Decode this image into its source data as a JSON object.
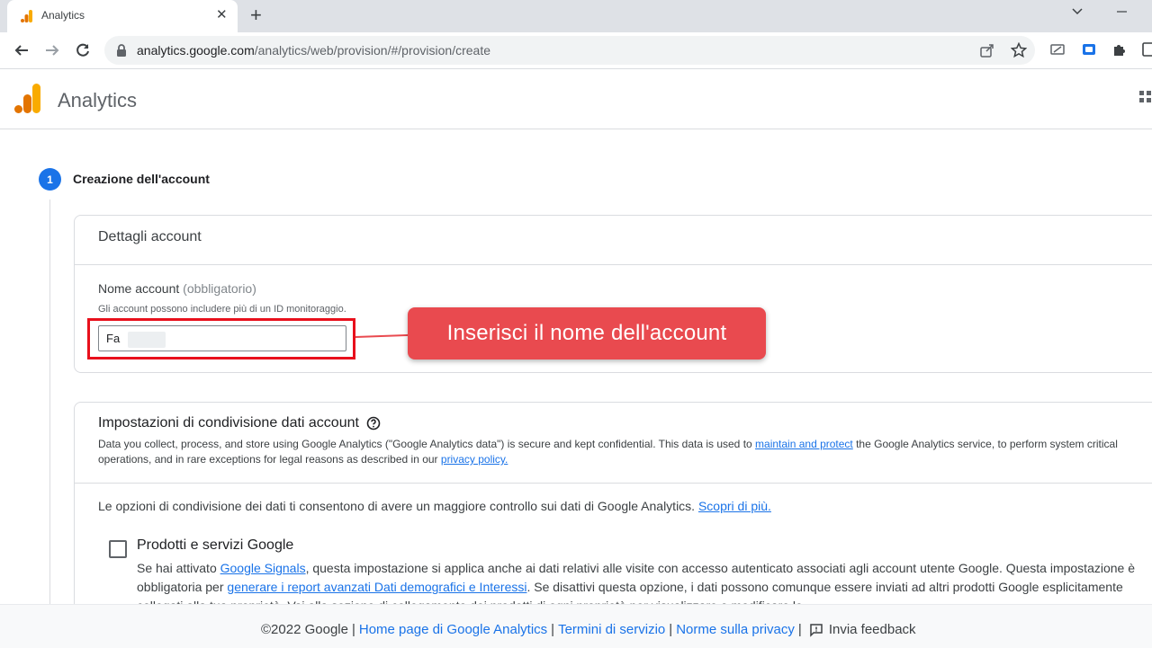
{
  "browser": {
    "tab_title": "Analytics",
    "url_host": "analytics.google.com",
    "url_path": "/analytics/web/provision/#/provision/create"
  },
  "app": {
    "title": "Analytics"
  },
  "step": {
    "number": "1",
    "title": "Creazione dell'account"
  },
  "account_details": {
    "title": "Dettagli account",
    "field_label": "Nome account",
    "field_optional": "(obbligatorio)",
    "field_help": "Gli account possono includere più di un ID monitoraggio.",
    "field_value": "Fa"
  },
  "sharing": {
    "title": "Impostazioni di condivisione dati account",
    "desc_part1": "Data you collect, process, and store using Google Analytics (\"Google Analytics data\") is secure and kept confidential. This data is used to ",
    "desc_link1": "maintain and protect",
    "desc_part2": " the Google Analytics service, to perform system critical operations, and in rare exceptions for legal reasons as described in our ",
    "desc_link2": "privacy policy.",
    "options_text": "Le opzioni di condivisione dei dati ti consentono di avere un maggiore controllo sui dati di Google Analytics. ",
    "options_link": "Scopri di più.",
    "product_title": "Prodotti e servizi Google",
    "product_desc_1": "Se hai attivato ",
    "product_link_1": "Google Signals",
    "product_desc_2": ", questa impostazione si applica anche ai dati relativi alle visite con accesso autenticato associati agli account utente Google. Questa impostazione è obbligatoria per ",
    "product_link_2": "generare i report avanzati Dati demografici e Interessi",
    "product_desc_3": ". Se disattivi questa opzione, i dati possono comunque essere inviati ad altri prodotti Google esplicitamente collegati alla tua proprietà. Vai alla sezione di collegamento dei prodotti di ogni proprietà per visualizzare o modificare le"
  },
  "annotation": {
    "callout_text": "Inserisci il nome dell'account",
    "color": "#e94a4f"
  },
  "footer": {
    "copyright": "©2022 Google",
    "link_home": "Home page di Google Analytics",
    "link_terms": "Termini di servizio",
    "link_privacy": "Norme sulla privacy",
    "feedback": "Invia feedback"
  },
  "colors": {
    "accent": "#1a73e8",
    "ga_orange": "#f9ab00",
    "ga_dark_orange": "#e37400"
  }
}
